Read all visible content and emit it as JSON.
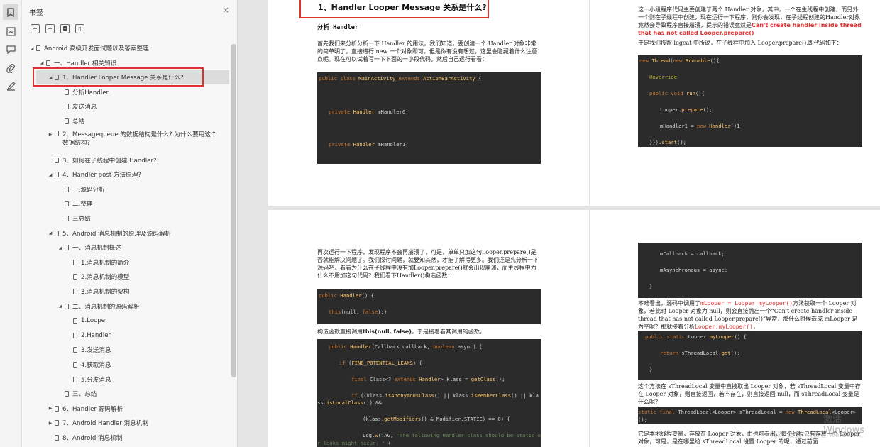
{
  "sidebar": {
    "title": "书签",
    "close": "×",
    "tree": [
      {
        "label": "Android 高级开发面试题以及答案整理",
        "level": 0,
        "arrow": "◢"
      },
      {
        "label": "一、Handler 相关知识",
        "level": 1,
        "arrow": "◢"
      },
      {
        "label": "1、Handler Looper Message 关系是什么?",
        "level": 2,
        "arrow": "◢",
        "selected": true
      },
      {
        "label": "分析Handler",
        "level": 3,
        "arrow": ""
      },
      {
        "label": "发送消息",
        "level": 3,
        "arrow": ""
      },
      {
        "label": "总结",
        "level": 3,
        "arrow": ""
      },
      {
        "label": "2、Messagequeue 的数据结构是什么? 为什么要用这个数据结构?",
        "level": 2,
        "arrow": "▶",
        "wrap": true
      },
      {
        "label": "3、如何在子线程中创建 Handler?",
        "level": 2,
        "arrow": ""
      },
      {
        "label": "4、Handler post 方法原理?",
        "level": 2,
        "arrow": "◢"
      },
      {
        "label": "一.源码分析",
        "level": 3,
        "arrow": ""
      },
      {
        "label": "二.整理",
        "level": 3,
        "arrow": ""
      },
      {
        "label": "三总结",
        "level": 3,
        "arrow": ""
      },
      {
        "label": "5、Android 消息机制的原理及源码解析",
        "level": 2,
        "arrow": "◢"
      },
      {
        "label": "一、消息机制概述",
        "level": 3,
        "arrow": "◢"
      },
      {
        "label": "1.消息机制的简介",
        "level": 4,
        "arrow": ""
      },
      {
        "label": "2.消息机制的模型",
        "level": 4,
        "arrow": ""
      },
      {
        "label": "3.消息机制的架构",
        "level": 4,
        "arrow": ""
      },
      {
        "label": "二、消息机制的源码解析",
        "level": 3,
        "arrow": "◢"
      },
      {
        "label": "1.Looper",
        "level": 4,
        "arrow": ""
      },
      {
        "label": "2.Handler",
        "level": 4,
        "arrow": ""
      },
      {
        "label": "3.发送消息",
        "level": 4,
        "arrow": ""
      },
      {
        "label": "4.获取消息",
        "level": 4,
        "arrow": ""
      },
      {
        "label": "5.分发消息",
        "level": 4,
        "arrow": ""
      },
      {
        "label": "三、总结",
        "level": 3,
        "arrow": ""
      },
      {
        "label": "6、Handler 源码解析",
        "level": 2,
        "arrow": "▶"
      },
      {
        "label": "7、Android Handler 消息机制",
        "level": 2,
        "arrow": "▶"
      },
      {
        "label": "8、Android 消息机制",
        "level": 2,
        "arrow": ""
      }
    ]
  },
  "doc": {
    "p1": {
      "heading": "1、Handler Looper Message 关系是什么?",
      "subheading": "分析 Handler",
      "para": "首先我们来分析分析一下 Handler 的用法，我们知道，要创建一个 Handler 对象非常的简单明了，直接进行 new 一个对象即可，但是你有没有想过，这里会隐藏着什么注意点呢。现在可以试着写一下下面的一小段代码，然后自己运行看看：",
      "code": [
        "public class MainActivity extends ActionBarActivity {",
        "private Handler mHandler0;",
        "private Handler mHandler1;"
      ]
    },
    "p2": {
      "para1_a": "这一小段程序代码主要创建了两个 Handler 对象，其中，一个在主线程中创建，而另外一个则在子线程中创建，现在运行一下程序，则你会发现，在子线程创建的Handler对象竟然会导致程序直接崩溃，提示的错误竟然是",
      "para1_red": "Can't create handler inside thread that has not called Looper.prepare()",
      "para2": "于是我们按照 logcat 中所说，在子线程中加入 Looper.prepare(),即代码如下：",
      "code": [
        "new Thread(new Runnable(){",
        "@override",
        "public void run(){",
        "Looper.prepare();",
        "mHandler1 = new Handler()1",
        "}}).start();"
      ]
    },
    "p3": {
      "para1": "再次运行一下程序，发现程序不会再崩溃了，可是，单单只加这句Looper.prepare()是否就能解决问题了。我们探讨问题，就要知其然，才能了解得更多。我们还是先分析一下源码吧，看看为什么在子线程中没有加Looper.prepare()就会出现崩溃，而主线程中为什么不用加这句代码？我们看下Handler()构造函数：",
      "code1": [
        "public Handler() {",
        "this(null, false);}"
      ],
      "para2_a": "构造函数直接调用",
      "para2_b": "this(null, false)",
      "para2_c": "。于是接着看其调用的函数，",
      "code2": [
        "public Handler(Callback callback, boolean async) {",
        "if (FIND_POTENTIAL_LEAKS) {",
        "final Class<? extends Handler> klass = getClass();",
        "if ((klass.isAnonymousClass() || klass.isMemberClass() || kla",
        "ss.isLocalClass()) &&",
        "(klass.getModifiers() & Modifier.STATIC) == 0) {",
        "Log.w(TAG, \"The following Handler class should be static o",
        "r leaks might occur: \" +"
      ]
    },
    "p4": {
      "code1": [
        "mCallback = callback;",
        "mAsynchronous = async;",
        "}"
      ],
      "para1_a": "不难看出，源码中调用了",
      "para1_b": "mLooper = Looper.myLooper()",
      "para1_c": "方法获取一个 Looper 对象，若此时 Looper 对象为 null，则会直接抛出一个“Can't create handler inside thread that has not called Looper.prepare()”异常，那什么时候造成 mLooper 是为空呢？那就接着分析",
      "para1_d": "Looper.myLooper()",
      "para1_e": "，",
      "code2": [
        "public static Looper myLooper() {",
        "return sThreadLocal.get();",
        "}"
      ],
      "para2": "这个方法在 sThreadLocal 变量中直接取出 Looper 对象，若 sThreadLocal 变量中存在 Looper 对象，则直接返回，若不存在，则直接返回 null，而 sThreadLocal 变量是什么呢？",
      "code3": [
        "static final ThreadLocal<Looper> sThreadLocal = new ThreadLocal<Looper>",
        "();"
      ],
      "para3": "它是本地线程变量，存放在 Looper 对象，由也可看出，每个线程只有存放一个 Looper 对象，可是，是在哪里给 sThreadLocal 设置 Looper 的呢，通过前面"
    }
  },
  "watermark": {
    "line1": "激活 Windows",
    "line2": "转到\"设置\"以激活 Windows。"
  }
}
